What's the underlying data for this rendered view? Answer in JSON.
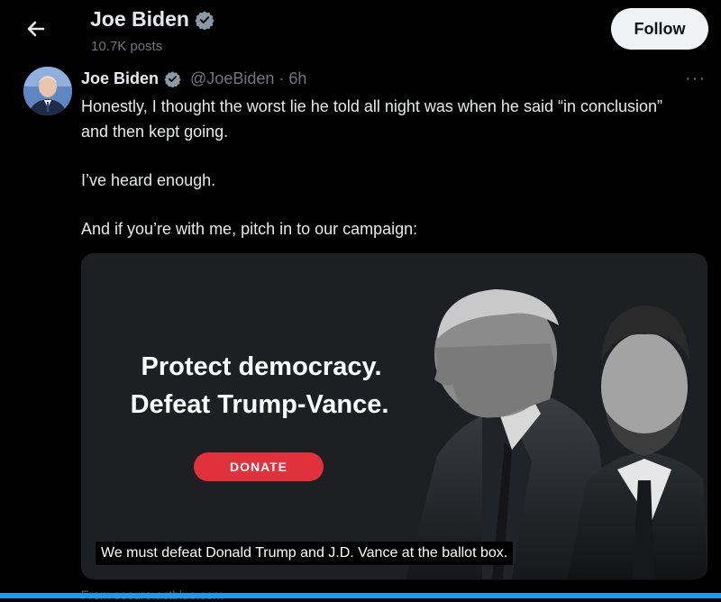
{
  "header": {
    "name": "Joe Biden",
    "posts": "10.7K posts",
    "follow_label": "Follow",
    "back_icon": "arrow-left-icon",
    "verified_icon": "verified-badge-icon"
  },
  "tweet": {
    "author_name": "Joe Biden",
    "handle": "@JoeBiden · 6h",
    "more_icon": "more-dots-icon",
    "text": [
      "Honestly, I thought the worst lie he told all night was when he said “in conclusion” and then kept going.",
      "I’ve heard enough.",
      "And if you’re with me, pitch in to our campaign:"
    ]
  },
  "media": {
    "headline_1": "Protect democracy.",
    "headline_2": "Defeat Trump-Vance.",
    "donate_label": "DONATE",
    "caption": "We must defeat Donald Trump and J.D. Vance at the ballot box."
  },
  "footer": {
    "link_text": "From secure.actblue.com"
  },
  "colors": {
    "background": "#000000",
    "card": "#1d1f22",
    "verified": "#8b98a5",
    "donate": "#e1313b",
    "accent": "#1d9bf0"
  }
}
